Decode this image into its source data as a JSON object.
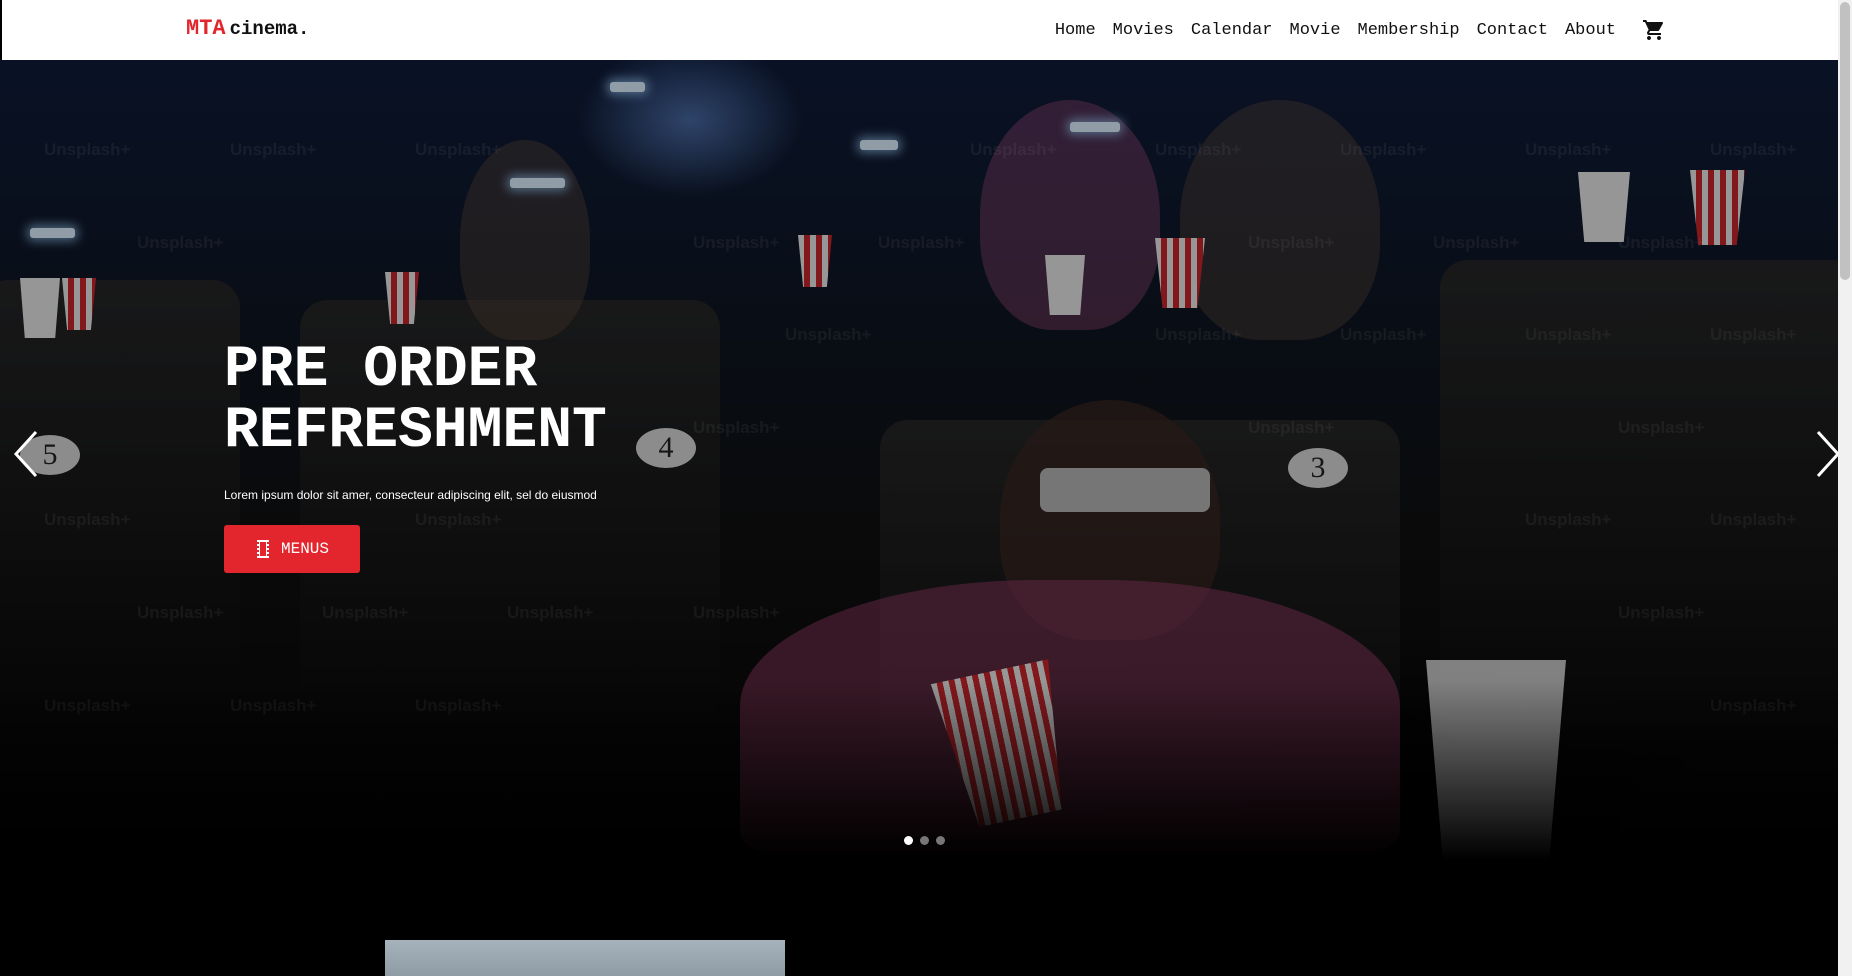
{
  "brand": {
    "accent": "MTA",
    "name": "cinema.",
    "accent_color": "#e3262d"
  },
  "nav": {
    "items": [
      "Home",
      "Movies",
      "Calendar",
      "Movie",
      "Membership",
      "Contact",
      "About"
    ],
    "cart_icon": "shopping-cart-icon"
  },
  "hero": {
    "title": "PRE ORDER REFRESHMENT",
    "subtitle": "Lorem ipsum dolor sit amer, consecteur adipiscing elit, sel do eiusmod",
    "button": {
      "label": "MENUS",
      "icon": "film-icon",
      "color": "#e3262d"
    },
    "seat_numbers": [
      "5",
      "4",
      "3"
    ],
    "watermark": "Unsplash+"
  },
  "carousel": {
    "slide_count": 3,
    "active_index": 0,
    "prev_icon": "chevron-left-icon",
    "next_icon": "chevron-right-icon"
  }
}
